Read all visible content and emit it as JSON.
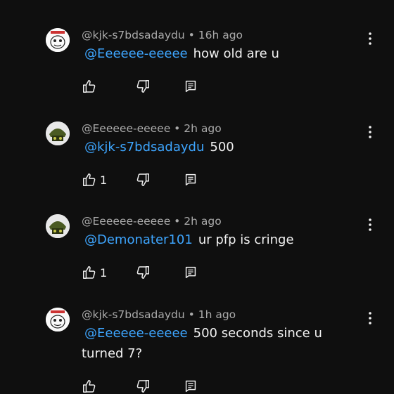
{
  "comments": [
    {
      "author": "@kjk-s7bdsadaydu",
      "time": "16h ago",
      "mention": "@Eeeeee-eeeee",
      "text": "how old are u",
      "likes": "",
      "avatar": "sketch-face"
    },
    {
      "author": "@Eeeeee-eeeee",
      "time": "2h ago",
      "mention": "@kjk-s7bdsadaydu",
      "text": "500",
      "likes": "1",
      "avatar": "green-helmet"
    },
    {
      "author": "@Eeeeee-eeeee",
      "time": "2h ago",
      "mention": "@Demonater101",
      "text": "ur pfp is cringe",
      "likes": "1",
      "avatar": "green-helmet"
    },
    {
      "author": "@kjk-s7bdsadaydu",
      "time": "1h ago",
      "mention": "@Eeeeee-eeeee",
      "text": "500 seconds since u turned 7?",
      "likes": "",
      "avatar": "sketch-face"
    }
  ],
  "separator": " • ",
  "colors": {
    "background": "#0f0f0f",
    "meta": "#aaaaaa",
    "mention": "#3ea6ff",
    "text": "#f1f1f1"
  }
}
